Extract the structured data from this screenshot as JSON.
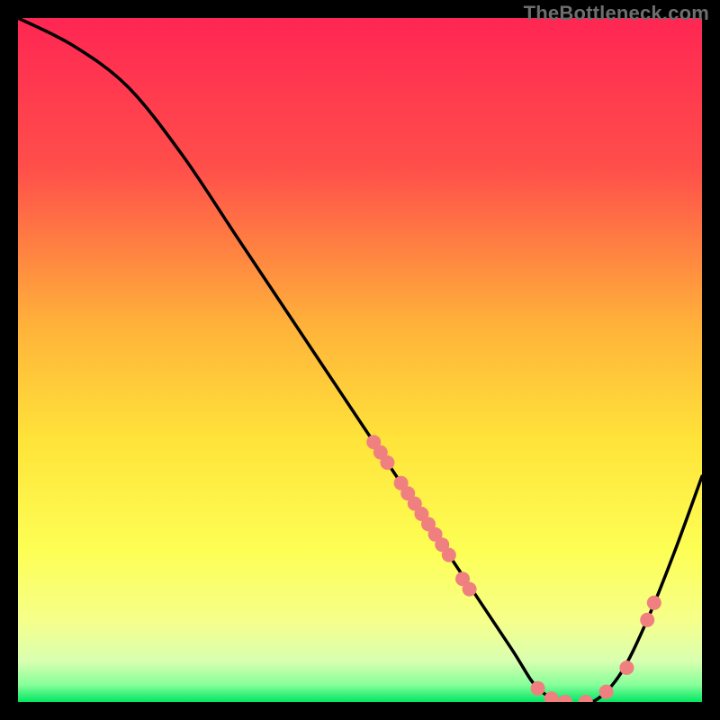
{
  "watermark": "TheBottleneck.com",
  "chart_data": {
    "type": "line",
    "title": "",
    "xlabel": "",
    "ylabel": "",
    "xlim": [
      0,
      100
    ],
    "ylim": [
      0,
      100
    ],
    "curve": [
      {
        "x": 0,
        "y": 100
      },
      {
        "x": 8,
        "y": 96
      },
      {
        "x": 16,
        "y": 90
      },
      {
        "x": 24,
        "y": 80
      },
      {
        "x": 32,
        "y": 68
      },
      {
        "x": 40,
        "y": 56
      },
      {
        "x": 48,
        "y": 44
      },
      {
        "x": 56,
        "y": 32
      },
      {
        "x": 64,
        "y": 20
      },
      {
        "x": 72,
        "y": 8
      },
      {
        "x": 76,
        "y": 2
      },
      {
        "x": 80,
        "y": 0
      },
      {
        "x": 84,
        "y": 0
      },
      {
        "x": 88,
        "y": 4
      },
      {
        "x": 92,
        "y": 12
      },
      {
        "x": 96,
        "y": 22
      },
      {
        "x": 100,
        "y": 33
      }
    ],
    "markers": [
      {
        "x": 52,
        "y": 38
      },
      {
        "x": 53,
        "y": 36.5
      },
      {
        "x": 54,
        "y": 35
      },
      {
        "x": 56,
        "y": 32
      },
      {
        "x": 57,
        "y": 30.5
      },
      {
        "x": 58,
        "y": 29
      },
      {
        "x": 59,
        "y": 27.5
      },
      {
        "x": 60,
        "y": 26
      },
      {
        "x": 61,
        "y": 24.5
      },
      {
        "x": 62,
        "y": 23
      },
      {
        "x": 63,
        "y": 21.5
      },
      {
        "x": 65,
        "y": 18
      },
      {
        "x": 66,
        "y": 16.5
      },
      {
        "x": 76,
        "y": 2
      },
      {
        "x": 78,
        "y": 0.5
      },
      {
        "x": 80,
        "y": 0
      },
      {
        "x": 83,
        "y": 0
      },
      {
        "x": 86,
        "y": 1.5
      },
      {
        "x": 89,
        "y": 5
      },
      {
        "x": 92,
        "y": 12
      },
      {
        "x": 93,
        "y": 14.5
      }
    ],
    "gradient_stops": [
      {
        "offset": 0.0,
        "color": "#ff2653"
      },
      {
        "offset": 0.22,
        "color": "#ff4f4a"
      },
      {
        "offset": 0.45,
        "color": "#ffb23a"
      },
      {
        "offset": 0.62,
        "color": "#ffe43a"
      },
      {
        "offset": 0.78,
        "color": "#fdff55"
      },
      {
        "offset": 0.88,
        "color": "#f6ff8a"
      },
      {
        "offset": 0.94,
        "color": "#d9ffb0"
      },
      {
        "offset": 0.975,
        "color": "#86ff9a"
      },
      {
        "offset": 1.0,
        "color": "#00e663"
      }
    ],
    "marker_color": "#f08080",
    "line_color": "#000000"
  }
}
